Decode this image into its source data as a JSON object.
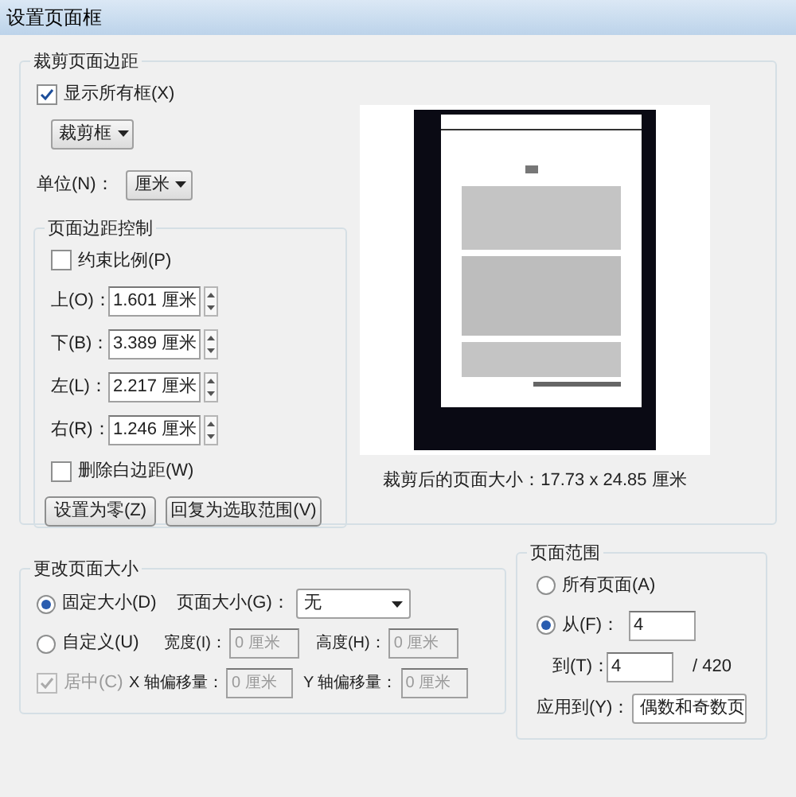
{
  "window": {
    "title": "设置页面框"
  },
  "crop_margins": {
    "title": "裁剪页面边距",
    "show_all_boxes": {
      "label": "显示所有框(X)",
      "checked": true
    },
    "box_dropdown": {
      "value": "裁剪框"
    },
    "unit": {
      "label": "单位(N)：",
      "value": "厘米"
    },
    "margin_control": {
      "title": "页面边距控制",
      "constrain": {
        "label": "约束比例(P)",
        "checked": false
      },
      "fields": [
        {
          "label": "上(O)：",
          "value": "1.601 厘米"
        },
        {
          "label": "下(B)：",
          "value": "3.389 厘米"
        },
        {
          "label": "左(L)：",
          "value": "2.217 厘米"
        },
        {
          "label": "右(R)：",
          "value": "1.246 厘米"
        }
      ],
      "remove_white": {
        "label": "删除白边距(W)",
        "checked": false
      },
      "buttons": [
        "设置为零(Z)",
        "回复为选取范围(V)"
      ]
    },
    "preview": {
      "caption": "裁剪后的页面大小：17.73 x 24.85 厘米"
    }
  },
  "change_page_size": {
    "title": "更改页面大小",
    "fixed": {
      "label": "固定大小(D)",
      "selected": true
    },
    "page_size": {
      "label": "页面大小(G)：",
      "value": "无"
    },
    "custom": {
      "label": "自定义(U)",
      "selected": false
    },
    "width": {
      "label": "宽度(I)：",
      "value": "0 厘米",
      "disabled": true
    },
    "height": {
      "label": "高度(H)：",
      "value": "0 厘米",
      "disabled": true
    },
    "center": {
      "label": "居中(C)",
      "checked": true,
      "disabled": true
    },
    "x_offset": {
      "label": "X 轴偏移量：",
      "value": "0 厘米",
      "disabled": true
    },
    "y_offset": {
      "label": "Y 轴偏移量：",
      "value": "0 厘米",
      "disabled": true
    }
  },
  "page_range": {
    "title": "页面范围",
    "all": {
      "label": "所有页面(A)",
      "selected": false
    },
    "from": {
      "label": "从(F)：",
      "selected": true,
      "value": "4"
    },
    "to": {
      "label": "到(T)：",
      "value": "4"
    },
    "total": "/ 420",
    "apply_to": {
      "label": "应用到(Y)：",
      "value": "偶数和奇数页"
    }
  }
}
